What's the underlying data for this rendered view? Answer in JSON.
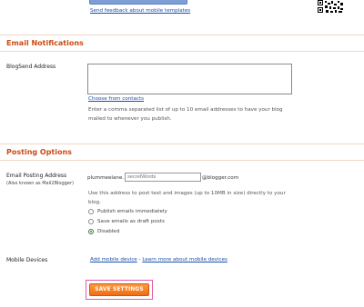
{
  "top": {
    "feedback_link": "Send feedback about mobile templates"
  },
  "email_notifications": {
    "title": "Email Notifications",
    "blogsend_label": "BlogSend Address",
    "textarea_value": "",
    "choose_contacts": "Choose from contacts",
    "help_text": "Enter a comma separated list of up to 10 email addresses to have your blog mailed to whenever you publish."
  },
  "posting_options": {
    "title": "Posting Options",
    "email_label": "Email Posting Address",
    "email_sublabel": "(Also known as Mail2Blogger)",
    "prefix": "plummeelane.",
    "secret_value": "",
    "secret_placeholder": "secretWords",
    "suffix": "@blogger.com",
    "help_text": "Use this address to post text and images (up to 10MB in size) directly to your blog.",
    "radios": [
      {
        "label": "Publish emails immediately",
        "checked": false
      },
      {
        "label": "Save emails as draft posts",
        "checked": false
      },
      {
        "label": "Disabled",
        "checked": true
      }
    ]
  },
  "mobile_devices": {
    "label": "Mobile Devices",
    "add_link": "Add mobile device",
    "separator": " - ",
    "learn_link": "Learn more about mobile devices"
  },
  "save_button": "SAVE SETTINGS"
}
